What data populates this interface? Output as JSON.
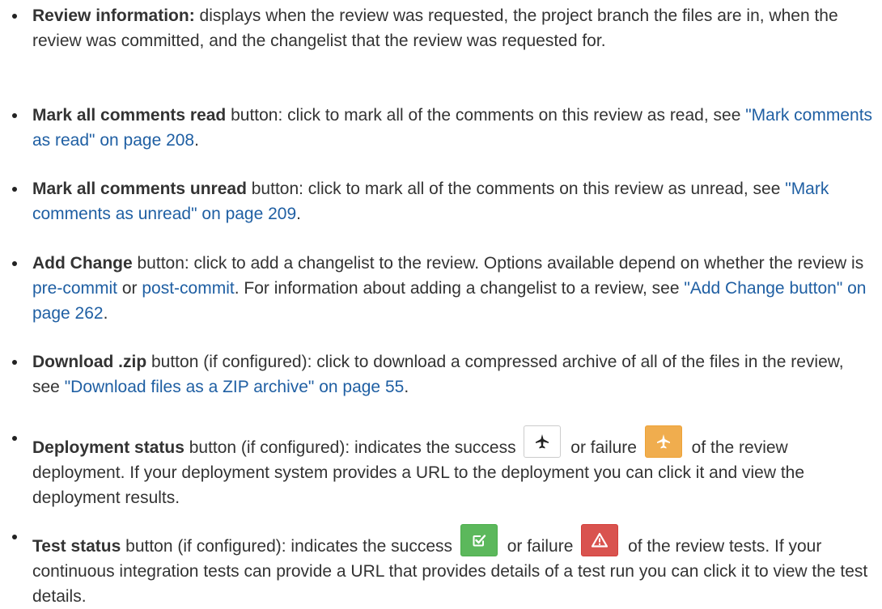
{
  "items": [
    {
      "term": "Review information:",
      "text": " displays when the review was requested, the project branch the files are in, when the review was committed, and the changelist that the review was requested for."
    },
    {
      "term": "Mark all comments read",
      "text1": " button: click to mark all of the comments on this review as read, see ",
      "link": "\"Mark comments as read\" on page 208",
      "text2": "."
    },
    {
      "term": "Mark all comments unread",
      "text1": " button: click to mark all of the comments on this review as unread, see ",
      "link": "\"Mark comments as unread\" on page 209",
      "text2": "."
    },
    {
      "term": "Add Change",
      "text1": " button: click to add a changelist to the review. Options available depend on whether the review is ",
      "link1": "pre-commit",
      "mid": " or ",
      "link2": "post-commit",
      "text2": ". For information about adding a changelist to a review, see ",
      "link3": "\"Add Change button\" on page 262",
      "text3": "."
    },
    {
      "term": "Download .zip",
      "text1": " button (if configured): click to download a compressed archive of all of the files in the review, see ",
      "link": "\"Download files as a ZIP archive\" on page 55",
      "text2": "."
    },
    {
      "term": "Deployment status",
      "text1": " button (if configured): indicates the success ",
      "text2": " or failure ",
      "text3": " of the review deployment. If your deployment system provides a URL to the deployment you can click it and view the deployment results."
    },
    {
      "term": "Test status",
      "text1": " button (if configured): indicates the success ",
      "text2": " or failure ",
      "text3": " of the review tests. If your continuous integration tests can provide a URL that provides details of a test run you can click it to view the test details."
    }
  ],
  "icons": {
    "deploy_success": "airplane-icon",
    "deploy_failure": "airplane-icon",
    "test_success": "check-square-icon",
    "test_failure": "warning-icon"
  },
  "colors": {
    "link": "#1f5fa3",
    "deploy_failure_bg": "#f0ad4e",
    "test_success_bg": "#5cb85c",
    "test_failure_bg": "#d9534f"
  }
}
